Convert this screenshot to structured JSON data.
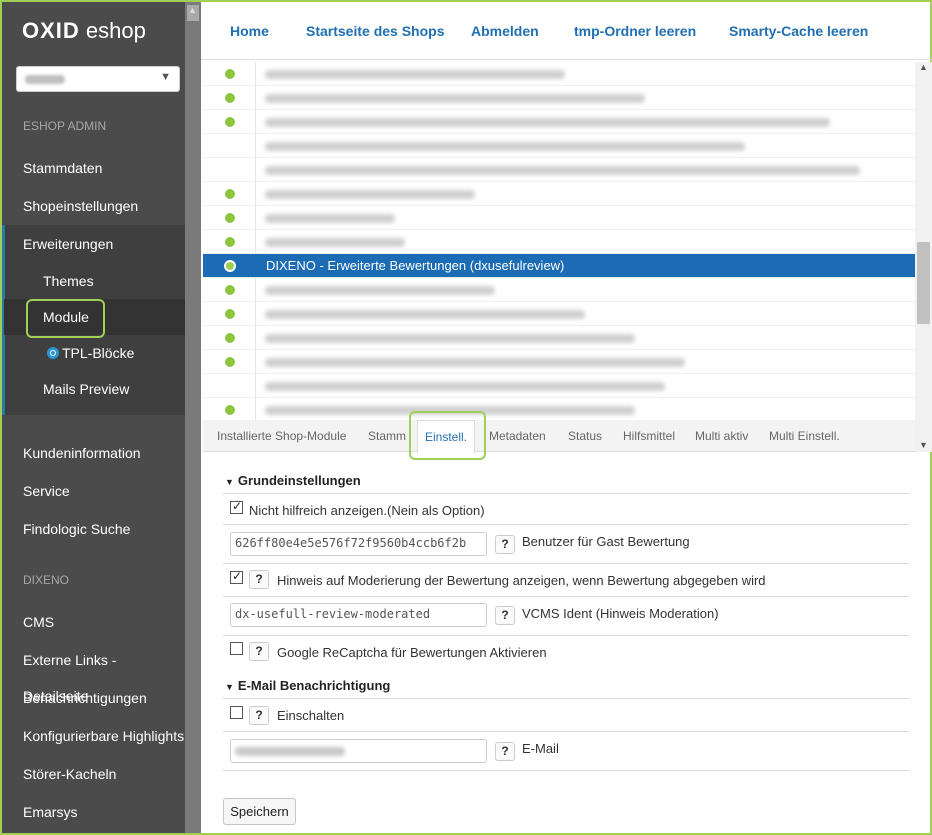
{
  "brand": {
    "bold": "OXID",
    "light": "eshop"
  },
  "sidebar": {
    "section_admin": "ESHOP ADMIN",
    "items_top": [
      "Stammdaten",
      "Shopeinstellungen",
      "Erweiterungen"
    ],
    "sub_items": [
      "Themes",
      "Module",
      "TPL-Blöcke",
      "Mails Preview"
    ],
    "items_mid": [
      "Kundeninformation",
      "Service",
      "Findologic Suche"
    ],
    "section_dixeno": "DIXENO",
    "items_bottom": [
      "CMS",
      "Externe Links - Detailseite",
      "Benachrichtigungen",
      "Konfigurierbare Highlights",
      "Störer-Kacheln",
      "Emarsys"
    ]
  },
  "topnav": [
    "Home",
    "Startseite des Shops",
    "Abmelden",
    "tmp-Ordner leeren",
    "Smarty-Cache leeren"
  ],
  "modules": {
    "selected_label": "DIXENO - Erweiterte Bewertungen (dxusefulreview)"
  },
  "tabs": [
    "Installierte Shop-Module",
    "Stamm",
    "Einstell.",
    "Metadaten",
    "Status",
    "Hilfsmittel",
    "Multi aktiv",
    "Multi Einstell."
  ],
  "settings": {
    "group1_title": "Grundeinstellungen",
    "opt1_label": "Nicht hilfreich anzeigen.(Nein als Option)",
    "opt1_checked": true,
    "guest_user_value": "626ff80e4e5e576f72f9560b4ccb6f2b",
    "guest_user_label": "Benutzer für Gast Bewertung",
    "opt2_label": "Hinweis auf Moderierung der Bewertung anzeigen, wenn Bewertung abgegeben wird",
    "opt2_checked": true,
    "vcms_value": "dx-usefull-review-moderated",
    "vcms_label": "VCMS Ident (Hinweis Moderation)",
    "opt3_label": "Google ReCaptcha für Bewertungen Aktivieren",
    "opt3_checked": false,
    "group2_title": "E-Mail Benachrichtigung",
    "opt4_label": "Einschalten",
    "opt4_checked": false,
    "email_label": "E-Mail",
    "help_glyph": "?"
  },
  "save_label": "Speichern"
}
